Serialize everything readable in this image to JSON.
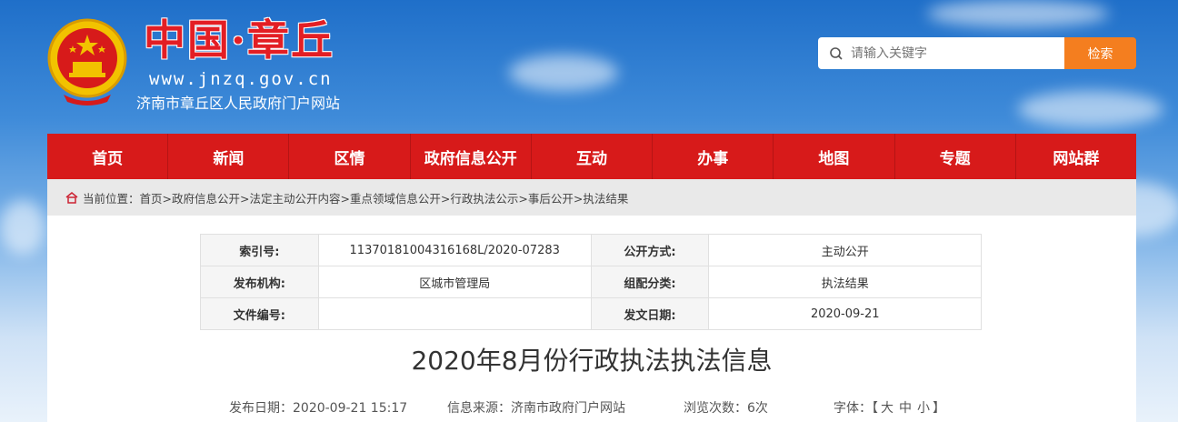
{
  "header": {
    "title": "中国·章丘",
    "url": "www.jnzq.gov.cn",
    "subtitle": "济南市章丘区人民政府门户网站"
  },
  "search": {
    "placeholder": "请输入关键字",
    "button_label": "检索"
  },
  "nav": {
    "items": [
      "首页",
      "新闻",
      "区情",
      "政府信息公开",
      "互动",
      "办事",
      "地图",
      "专题",
      "网站群"
    ]
  },
  "breadcrumb": {
    "text": "当前位置：首页>政府信息公开>法定主动公开内容>重点领域信息公开>行政执法公示>事后公开>执法结果"
  },
  "meta_table": {
    "rows": [
      {
        "l1": "索引号:",
        "v1": "11370181004316168L/2020-07283",
        "l2": "公开方式:",
        "v2": "主动公开"
      },
      {
        "l1": "发布机构:",
        "v1": "区城市管理局",
        "l2": "组配分类:",
        "v2": "执法结果"
      },
      {
        "l1": "文件编号:",
        "v1": "",
        "l2": "发文日期:",
        "v2": "2020-09-21"
      }
    ]
  },
  "article": {
    "title": "2020年8月份行政执法执法信息",
    "publish_date": "发布日期：2020-09-21 15:17",
    "source": "信息来源：济南市政府门户网站",
    "views": "浏览次数：6次",
    "font_size_label": "字体：【",
    "font_large": "大",
    "font_medium": "中",
    "font_small": "小",
    "font_close": "】"
  },
  "colors": {
    "nav_red": "#d71a1a",
    "search_orange": "#f47e1f",
    "title_red": "#e31e24"
  }
}
